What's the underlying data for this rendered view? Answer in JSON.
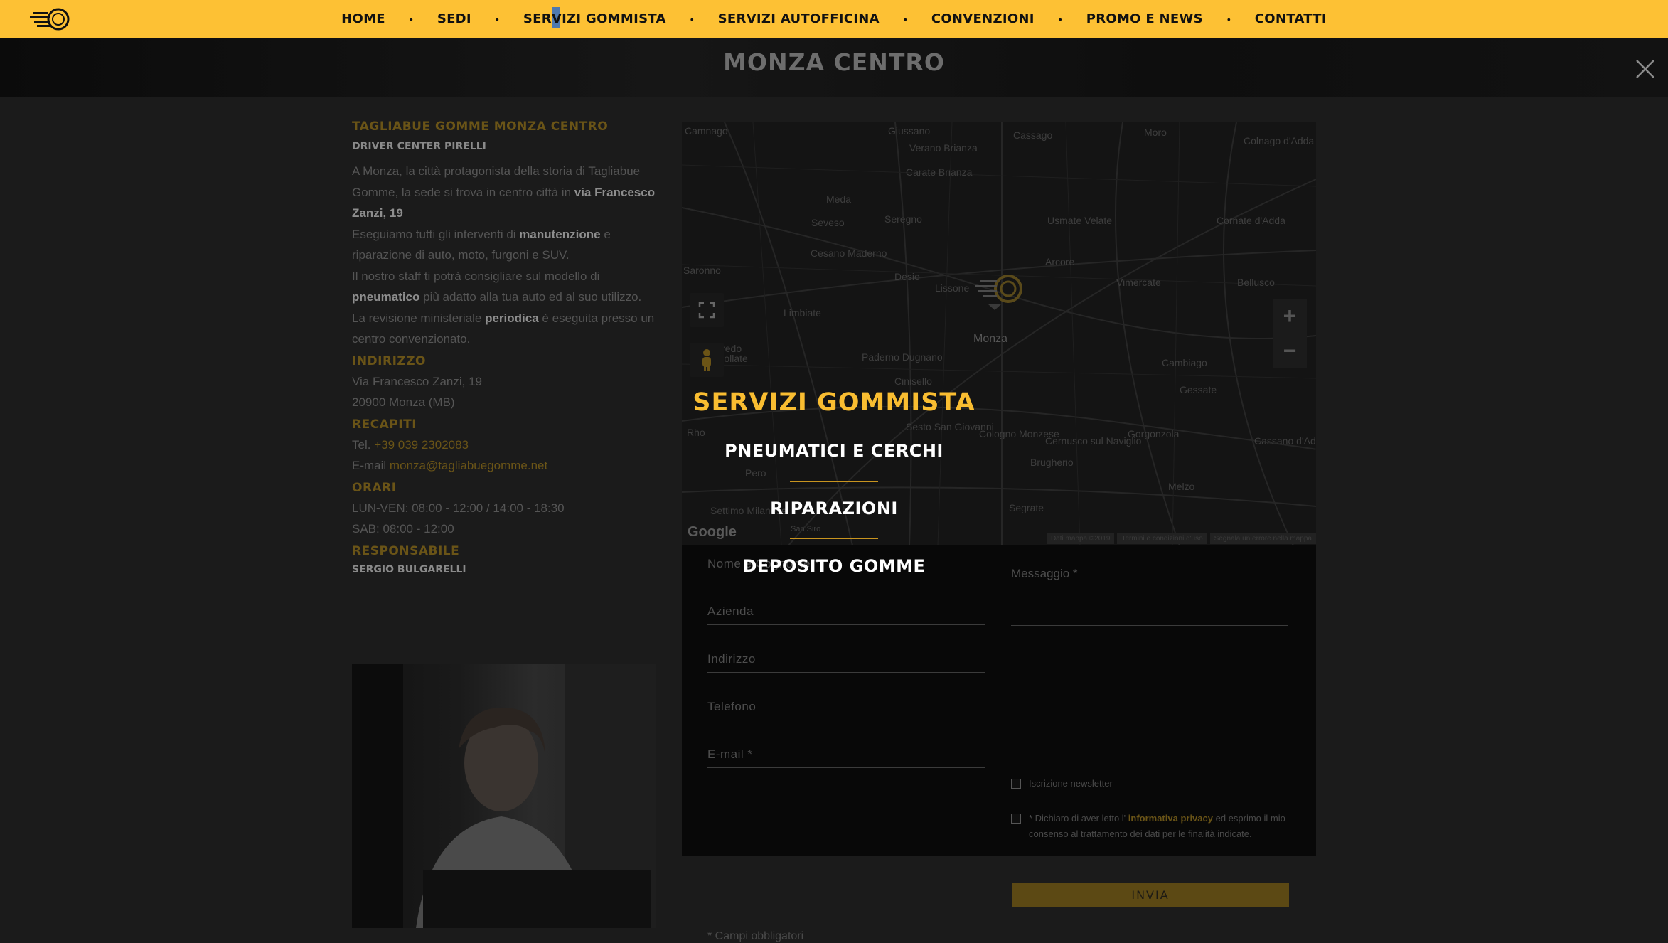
{
  "nav": {
    "items": [
      "HOME",
      "SEDI",
      "SERVIZI GOMMISTA",
      "SERVIZI AUTOFFICINA",
      "CONVENZIONI",
      "PROMO E NEWS",
      "CONTATTI"
    ],
    "separator": "•",
    "active_index": 2
  },
  "page": {
    "title": "MONZA CENTRO"
  },
  "info": {
    "heading": "TAGLIABUE GOMME MONZA CENTRO",
    "subheading": "DRIVER CENTER PIRELLI",
    "p1_a": "A Monza, la città protagonista della storia di Tagliabue Gomme, la sede si trova in centro città in ",
    "p1_b": "via Francesco Zanzi, 19",
    "p2_a": "Eseguiamo tutti gli interventi di ",
    "p2_b": "manutenzione",
    "p2_c": " e riparazione di auto, moto, furgoni e SUV.",
    "p3_a": "Il nostro staff ti potrà consigliare sul modello di ",
    "p3_b": "pneumatico",
    "p3_c": " più adatto alla tua auto ed al suo utilizzo.",
    "p4_a": "La revisione ministeriale ",
    "p4_b": "periodica",
    "p4_c": " è eseguita presso un centro convenzionato.",
    "address_label": "INDIRIZZO",
    "address_line1": "Via Francesco Zanzi, 19",
    "address_line2": "20900 Monza (MB)",
    "contacts_label": "RECAPITI",
    "tel_label": "Tel. ",
    "tel_value": "+39 039 2302083",
    "email_label": "E-mail ",
    "email_value": "monza@tagliabuegomme.net",
    "hours_label": "ORARI",
    "hours_line1": "LUN-VEN: 08:00 - 12:00 / 14:00 - 18:30",
    "hours_line2": "SAB: 08:00 - 12:00",
    "manager_label": "RESPONSABILE",
    "manager_name": "SERGIO BULGARELLI"
  },
  "map": {
    "labels": [
      "Camnago",
      "Giussano",
      "Verano Brianza",
      "Carate Brianza",
      "Cassago",
      "Moro",
      "Colnago d'Adda",
      "Meda",
      "Seveso",
      "Seregno",
      "Usmate Velate",
      "Cornate d'Adda",
      "Cesano Maderno",
      "Desio",
      "Lissone",
      "Arcore",
      "Vimercate",
      "Bellusco",
      "Limbiate",
      "Monza",
      "Paderno Dugnano",
      "Cinisello",
      "Cambiago",
      "Gessate",
      "Bollate",
      "Sesto San Giovanni",
      "Cologno Monzese",
      "Cernusco sul Naviglio",
      "Gorgonzola",
      "Rho",
      "Pero",
      "Settimo Milanese",
      "Segrate",
      "Melzo",
      "Saronno",
      "Varedo",
      "San Siro",
      "Cassano d'Adda",
      "Brugherio"
    ],
    "zoom_in": "+",
    "zoom_out": "−",
    "google": "Google",
    "legal": [
      "Dati mappa ©2019",
      "Termini e condizioni d'uso",
      "Segnala un errore nella mappa"
    ]
  },
  "form": {
    "name_placeholder": "Nome e Cognome *",
    "company_placeholder": "Azienda",
    "address_placeholder": "Indirizzo",
    "phone_placeholder": "Telefono",
    "email_placeholder": "E-mail *",
    "message_placeholder": "Messaggio *",
    "newsletter_label": "Iscrizione newsletter",
    "privacy_a": "* Dichiaro di aver letto l' ",
    "privacy_link": "informativa privacy",
    "privacy_b": " ed esprimo il mio consenso al trattamento dei dati per le finalità indicate.",
    "submit": "INVIA",
    "required_note": "* Campi obbligatori"
  },
  "dropdown": {
    "title": "SERVIZI GOMMISTA",
    "items": [
      "PNEUMATICI E CERCHI",
      "RIPARAZIONI",
      "DEPOSITO GOMME"
    ]
  },
  "colors": {
    "accent": "#fdc134",
    "dropdown_title": "#f9bd31",
    "background": "#1b1b1b"
  }
}
